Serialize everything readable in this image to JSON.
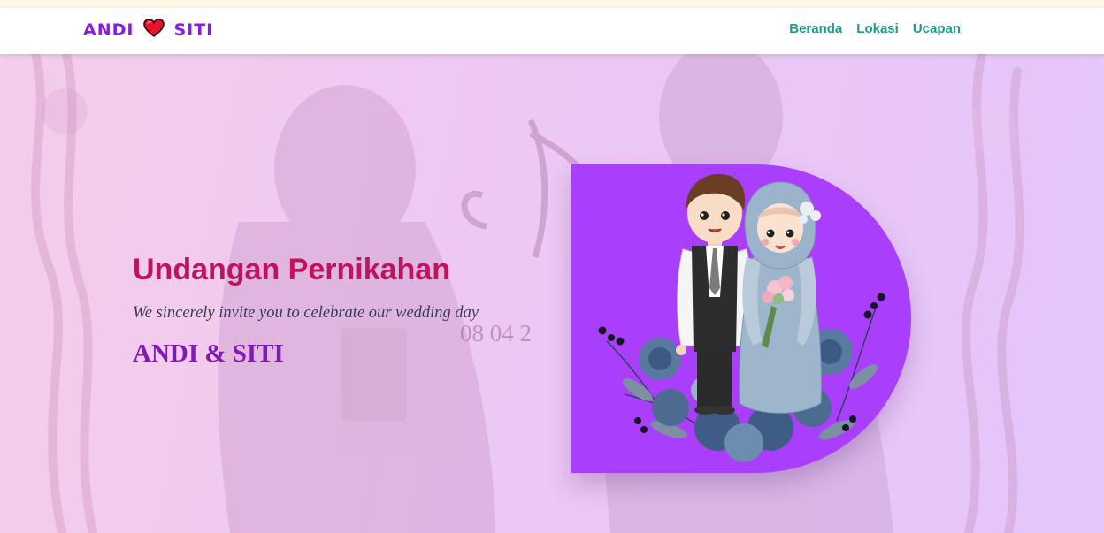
{
  "navbar": {
    "brand_left": "ANDI",
    "brand_right": "SITI",
    "links": [
      "Beranda",
      "Lokasi",
      "Ucapan"
    ]
  },
  "hero": {
    "title": "Undangan Pernikahan",
    "tagline": "We sincerely invite you to celebrate our wedding day",
    "couple_names": "ANDI & SITI",
    "background_watermark": "08 04 2"
  },
  "icons": {
    "heart": "heart-icon"
  },
  "colors": {
    "brand": "#8a18e6",
    "nav_link": "#1d9a8e",
    "title": "#c0125e",
    "names": "#7d1ab8",
    "card": "#a93ffc"
  }
}
